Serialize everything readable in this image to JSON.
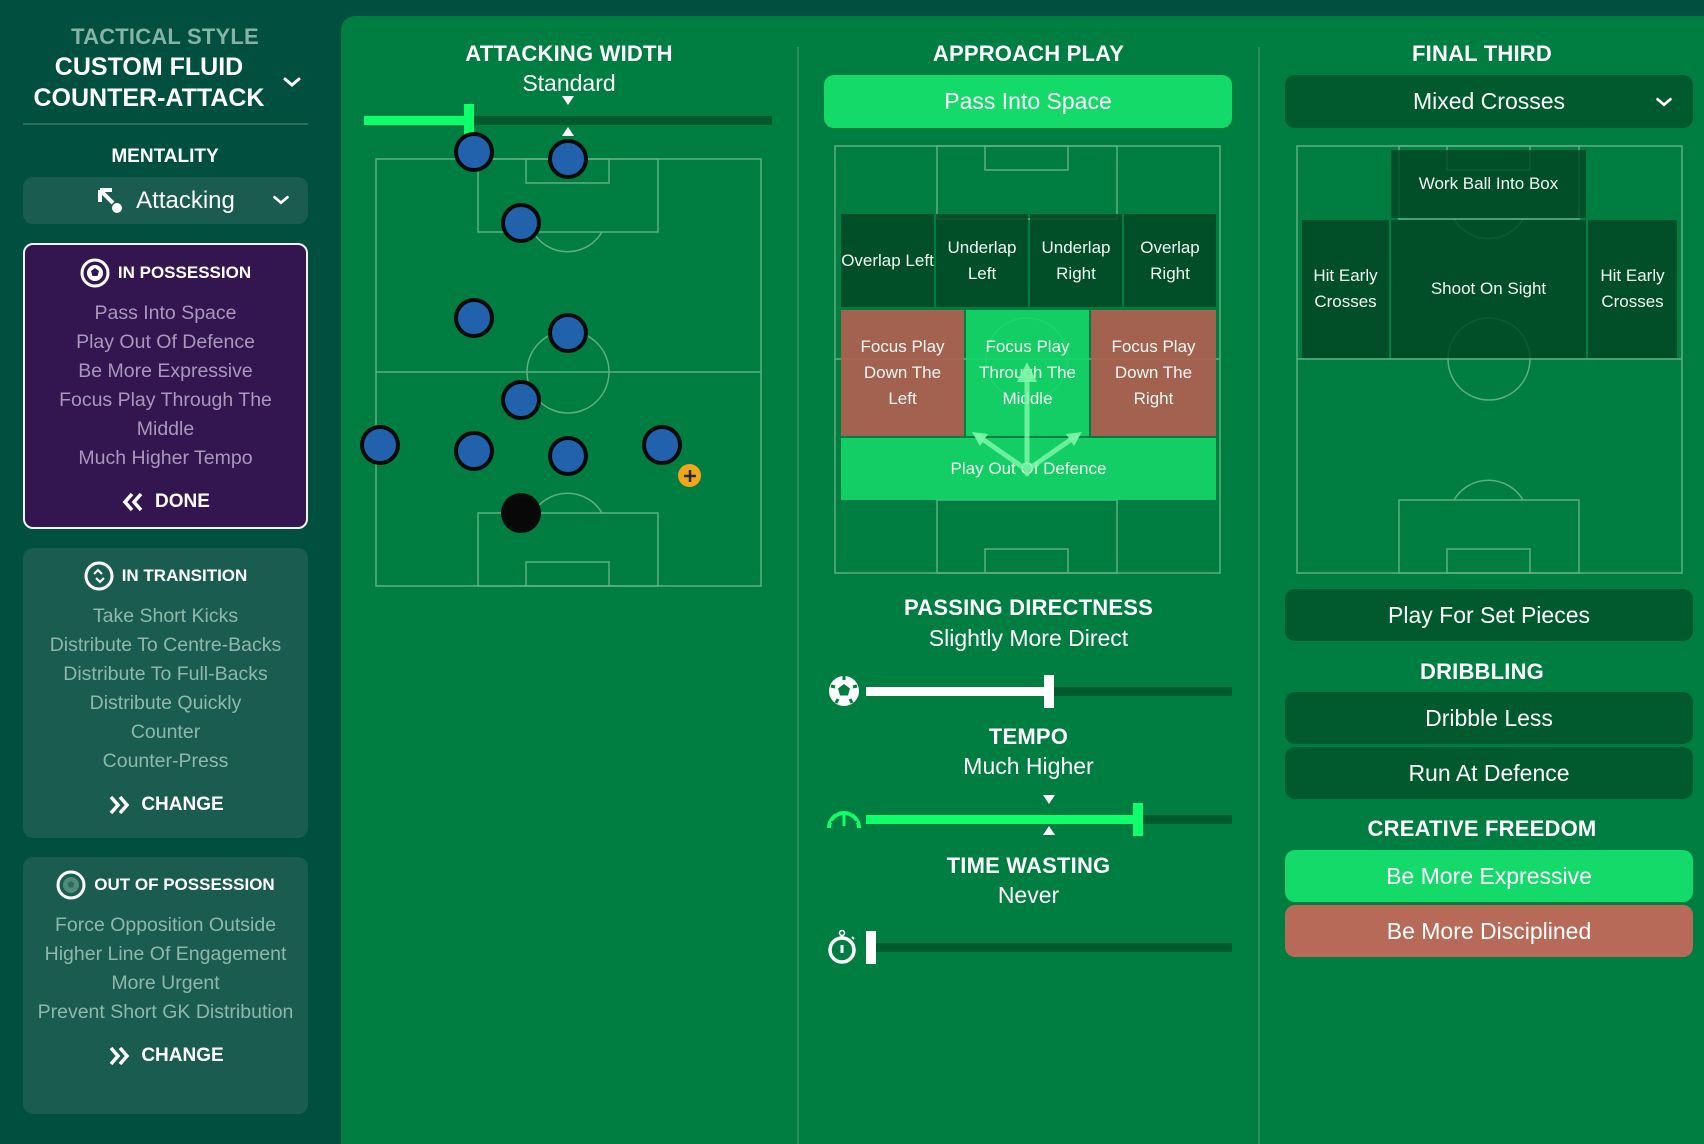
{
  "sidebar": {
    "tactical_style_label": "TACTICAL STYLE",
    "tactical_style_line1": "CUSTOM FLUID",
    "tactical_style_line2": "COUNTER-ATTACK",
    "mentality_label": "MENTALITY",
    "mentality_value": "Attacking",
    "cards": [
      {
        "title": "IN POSSESSION",
        "icon": "ball-icon",
        "items": [
          "Pass Into Space",
          "Play Out Of Defence",
          "Be More Expressive",
          "Focus Play Through The Middle",
          "Much Higher Tempo"
        ],
        "action": "DONE",
        "active": true
      },
      {
        "title": "IN TRANSITION",
        "icon": "transition-icon",
        "items": [
          "Take Short Kicks",
          "Distribute To Centre-Backs",
          "Distribute To Full-Backs",
          "Distribute Quickly",
          "Counter",
          "Counter-Press"
        ],
        "action": "CHANGE",
        "active": false
      },
      {
        "title": "OUT OF POSSESSION",
        "icon": "ball-outline-icon",
        "items": [
          "Force Opposition Outside",
          "Higher Line Of Engagement",
          "More Urgent",
          "Prevent Short GK Distribution"
        ],
        "action": "CHANGE",
        "active": false
      }
    ]
  },
  "attacking_width": {
    "title": "ATTACKING WIDTH",
    "value": "Standard",
    "slider_fraction": 0.25,
    "default_fraction": 0.5
  },
  "approach_play": {
    "title": "APPROACH PLAY",
    "selected": "Pass Into Space",
    "zones": {
      "overlap_left": "Overlap Left",
      "underlap_left": "Underlap Left",
      "underlap_right": "Underlap Right",
      "overlap_right": "Overlap Right",
      "focus_left": "Focus Play Down The Left",
      "focus_middle": "Focus Play Through The Middle",
      "focus_right": "Focus Play Down The Right",
      "play_out": "Play Out Of Defence"
    }
  },
  "passing_directness": {
    "title": "PASSING DIRECTNESS",
    "value": "Slightly More Direct",
    "slider_fraction": 0.5
  },
  "tempo": {
    "title": "TEMPO",
    "value": "Much Higher",
    "slider_fraction": 0.75,
    "default_fraction": 0.5
  },
  "time_wasting": {
    "title": "TIME WASTING",
    "value": "Never",
    "slider_fraction": 0.0
  },
  "final_third": {
    "title": "FINAL THIRD",
    "crossing": "Mixed Crosses",
    "zones": {
      "work_ball": "Work Ball Into Box",
      "hit_early_left": "Hit Early Crosses",
      "shoot": "Shoot On Sight",
      "hit_early_right": "Hit Early Crosses"
    },
    "set_pieces": "Play For Set Pieces"
  },
  "dribbling": {
    "title": "DRIBBLING",
    "options": [
      "Dribble Less",
      "Run At Defence"
    ]
  },
  "creative_freedom": {
    "title": "CREATIVE FREEDOM",
    "expressive": "Be More Expressive",
    "disciplined": "Be More Disciplined"
  },
  "colors": {
    "accent_green": "#14da6a",
    "slider_green": "#0dff6a",
    "negative_red": "#b86a58",
    "possession_purple": "#331650",
    "player_blue": "#2262ad"
  }
}
